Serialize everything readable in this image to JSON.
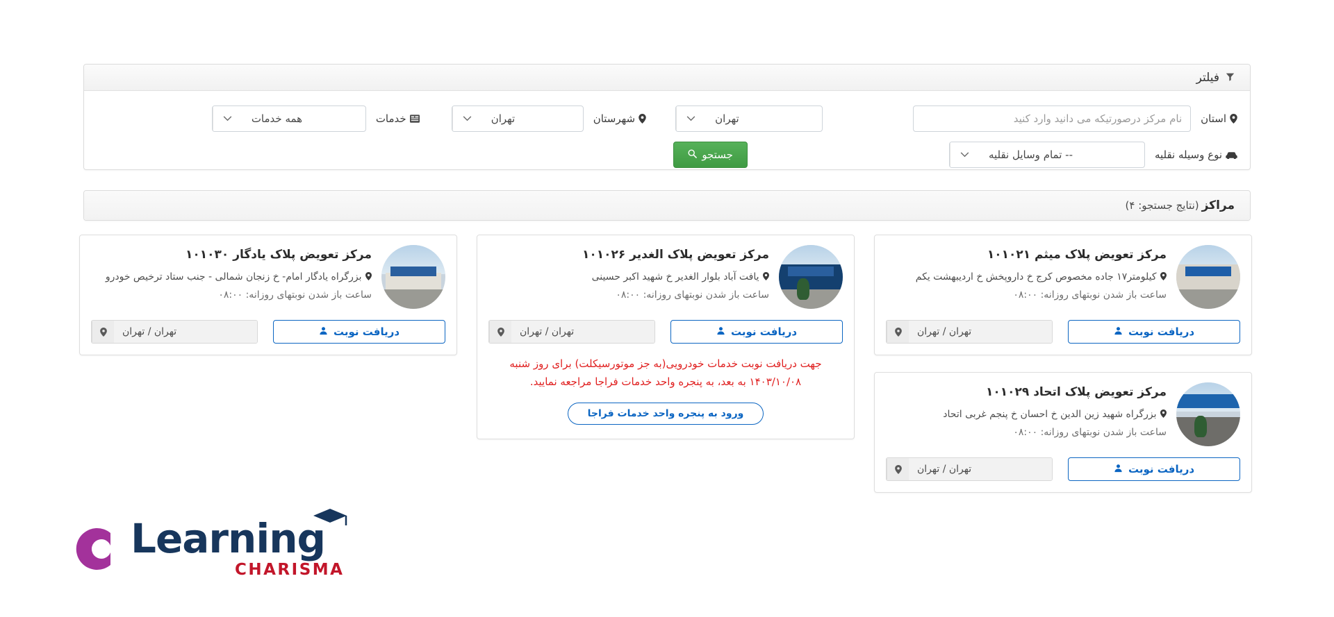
{
  "filter": {
    "header_label": "فیلتر",
    "header_icon": "funnel-icon",
    "center_name": {
      "placeholder": "نام مرکز درصورتیکه می دانید وارد کنید",
      "value": ""
    },
    "province": {
      "label": "استان",
      "icon": "map-pin-icon",
      "value": "تهران"
    },
    "county": {
      "label": "شهرستان",
      "icon": "map-pin-icon",
      "value": "تهران"
    },
    "services": {
      "label": "خدمات",
      "icon": "list-icon",
      "value": "همه خدمات"
    },
    "vehicle": {
      "label": "نوع وسیله نقلیه",
      "icon": "car-icon",
      "value": "-- تمام وسایل نقلیه"
    },
    "search_button": {
      "label": "جستجو",
      "icon": "search-icon"
    }
  },
  "results": {
    "title": "مراکز",
    "count_label": "(نتایج جستجو: ۴)"
  },
  "labels": {
    "appointment_button": "دریافت نوبت",
    "appointment_icon": "person-icon",
    "location_icon": "map-pin-icon",
    "pin_glyph": "location-pin-icon"
  },
  "cards": [
    {
      "id": "yadegar",
      "title": "مرکز تعویض پلاک یادگار ۱۰۱۰۳۰",
      "address": "بزرگراه یادگار امام- خ زنجان شمالی - جنب ستاد ترخیص خودرو",
      "hours": "ساعت باز شدن نوبتهای روزانه: ۰۸:۰۰",
      "location": "تهران / تهران",
      "button": "دریافت نوبت",
      "image_name": "center-photo-yadegar"
    },
    {
      "id": "alghadir",
      "title": "مرکز تعویض پلاک الغدیر ۱۰۱۰۲۶",
      "address": "یافت آباد بلوار الغدیر خ شهید اکبر حسینی",
      "hours": "ساعت باز شدن نوبتهای روزانه: ۰۸:۰۰",
      "location": "تهران / تهران",
      "button": "دریافت نوبت",
      "image_name": "center-photo-alghadir",
      "notice": "جهت دریافت نوبت خدمات خودرویی(به جز موتورسیکلت) برای روز شنبه ۱۴۰۳/۱۰/۰۸ به بعد، به پنجره واحد خدمات فراجا مراجعه نمایید.",
      "notice_button": "ورود به پنجره واحد خدمات فراجا"
    },
    {
      "id": "meysam",
      "title": "مرکز تعویض پلاک میثم ۱۰۱۰۲۱",
      "address": "کیلومتر۱۷ جاده مخصوص کرج خ داروپخش خ اردیبهشت یکم",
      "hours": "ساعت باز شدن نوبتهای روزانه: ۰۸:۰۰",
      "location": "تهران / تهران",
      "button": "دریافت نوبت",
      "image_name": "center-photo-meysam"
    },
    {
      "id": "ettehad",
      "title": "مرکز تعویض پلاک اتحاد ۱۰۱۰۲۹",
      "address": "بزرگراه شهید زین الدین خ احسان خ پنجم غربی اتحاد",
      "hours": "ساعت باز شدن نوبتهای روزانه: ۰۸:۰۰",
      "location": "تهران / تهران",
      "button": "دریافت نوبت",
      "image_name": "center-photo-ettehad"
    }
  ],
  "logo": {
    "word": "Learning",
    "sub": "CHARISMA",
    "mark_color": "#a3329b",
    "word_color": "#17365c",
    "sub_color": "#c2162a"
  },
  "colors": {
    "accent_blue": "#0b65c2",
    "search_green": "#3f9b43",
    "notice_red": "#e02020",
    "panel_border": "#dcdcdc"
  }
}
